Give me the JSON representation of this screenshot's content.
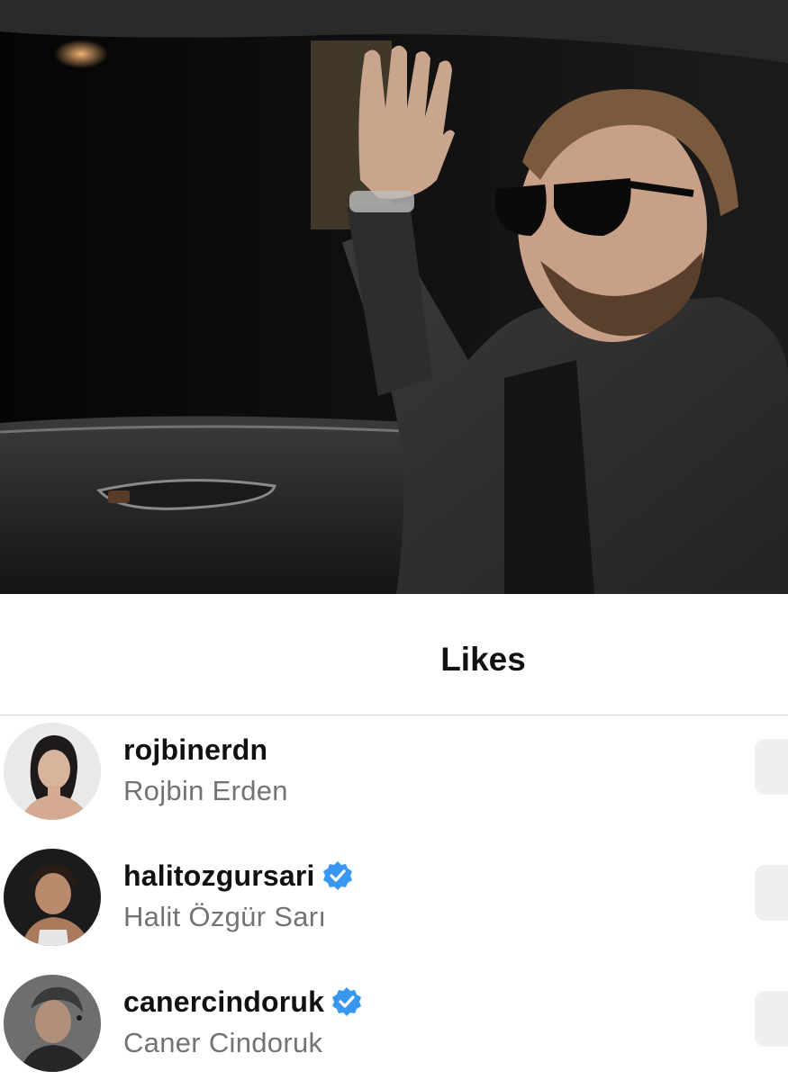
{
  "sheet": {
    "title": "Likes"
  },
  "likes": [
    {
      "username": "rojbinerdn",
      "full_name": "Rojbin Erden",
      "verified": false,
      "avatar_icon": "avatar-woman-photo"
    },
    {
      "username": "halitozgursari",
      "full_name": "Halit Özgür Sarı",
      "verified": true,
      "avatar_icon": "avatar-man-photo"
    },
    {
      "username": "canercindoruk",
      "full_name": "Caner Cindoruk",
      "verified": true,
      "avatar_icon": "avatar-man-gray-hair-photo"
    }
  ],
  "colors": {
    "verified_blue": "#3897f0",
    "secondary_text": "#737373",
    "divider": "#dbdbdb"
  }
}
